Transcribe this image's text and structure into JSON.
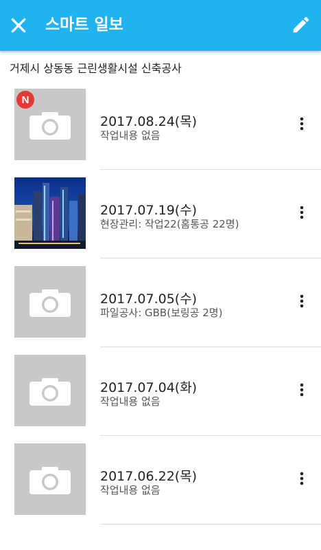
{
  "appbar": {
    "title": "스마트 일보",
    "background": "#1fb3f0"
  },
  "project_name": "거제시 상동동 근린생활시설 신축공사",
  "entries": [
    {
      "date": "2017.08.24(목)",
      "description": "작업내용 없음",
      "badge": "N",
      "thumbnail": "camera-placeholder"
    },
    {
      "date": "2017.07.19(수)",
      "description": "현장관리: 작업22(홈통공 22명)",
      "thumbnail": "city-night-photo"
    },
    {
      "date": "2017.07.05(수)",
      "description": "파일공사: GBB(보링공 2명)",
      "thumbnail": "camera-placeholder"
    },
    {
      "date": "2017.07.04(화)",
      "description": "작업내용 없음",
      "thumbnail": "camera-placeholder"
    },
    {
      "date": "2017.06.22(목)",
      "description": "작업내용 없음",
      "thumbnail": "camera-placeholder"
    }
  ]
}
